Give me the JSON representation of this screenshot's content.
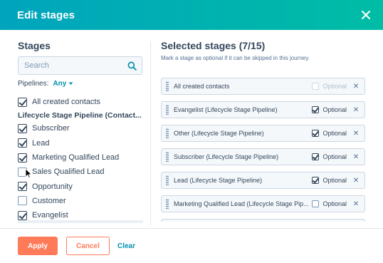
{
  "modal": {
    "title": "Edit stages",
    "close_icon": "close-icon"
  },
  "stages": {
    "title": "Stages",
    "search_placeholder": "Search",
    "pipelines_label": "Pipelines:",
    "pipelines_value": "Any",
    "all_contacts_label": "All created contacts",
    "all_contacts_checked": true,
    "group_label": "Lifecycle Stage Pipeline (Contact...",
    "options": [
      {
        "label": "Subscriber",
        "checked": true
      },
      {
        "label": "Lead",
        "checked": true
      },
      {
        "label": "Marketing Qualified Lead",
        "checked": true
      },
      {
        "label": "Sales Qualified Lead",
        "checked": false
      },
      {
        "label": "Opportunity",
        "checked": true
      },
      {
        "label": "Customer",
        "checked": false
      },
      {
        "label": "Evangelist",
        "checked": true
      }
    ]
  },
  "selected": {
    "title": "Selected stages (7/15)",
    "hint": "Mark a stage as optional if it can be skipped in this journey.",
    "optional_label": "Optional",
    "items": [
      {
        "name": "All created contacts",
        "optional": false,
        "disabled": true
      },
      {
        "name": "Evangelist (Lifecycle Stage Pipeline)",
        "optional": true,
        "disabled": false
      },
      {
        "name": "Other (Lifecycle Stage Pipeline)",
        "optional": true,
        "disabled": false
      },
      {
        "name": "Subscriber (Lifecycle Stage Pipeline)",
        "optional": true,
        "disabled": false
      },
      {
        "name": "Lead (Lifecycle Stage Pipeline)",
        "optional": true,
        "disabled": false
      },
      {
        "name": "Marketing Qualified Lead (Lifecycle Stage Pip...",
        "optional": false,
        "disabled": false
      }
    ]
  },
  "footer": {
    "apply_label": "Apply",
    "cancel_label": "Cancel",
    "clear_label": "Clear"
  },
  "colors": {
    "header_start": "#00a4bd",
    "header_end": "#00bda5",
    "primary": "#ff7a59",
    "link": "#0091ae"
  }
}
